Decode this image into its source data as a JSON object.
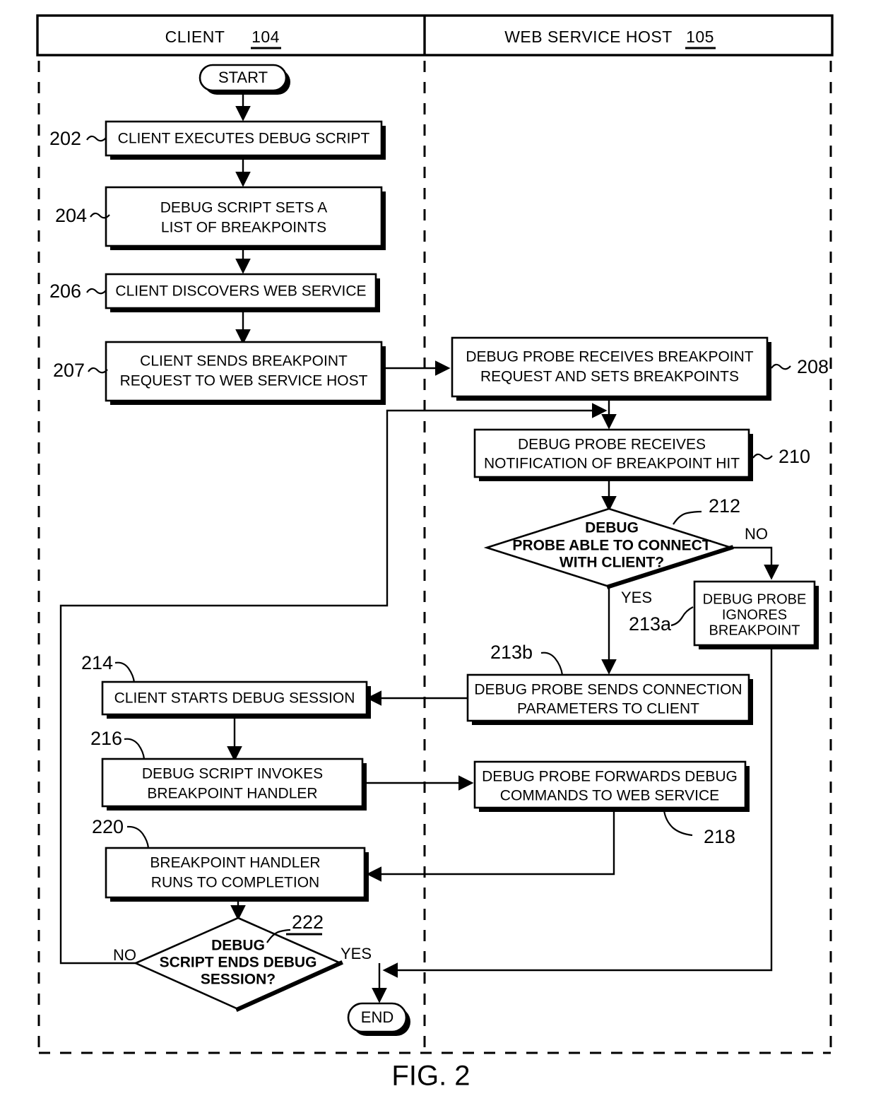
{
  "figure": {
    "caption": "FIG. 2"
  },
  "lanes": [
    {
      "id": "client",
      "title": "CLIENT",
      "ref": "104"
    },
    {
      "id": "web_service_host",
      "title": "WEB SERVICE HOST",
      "ref": "105"
    }
  ],
  "terminators": {
    "start": "START",
    "end": "END"
  },
  "branch_labels": {
    "d212_no": "NO",
    "d212_yes": "YES",
    "d222_no": "NO",
    "d222_yes": "YES"
  },
  "nodes": {
    "n202": {
      "ref": "202",
      "line1": "CLIENT EXECUTES DEBUG SCRIPT",
      "line2": ""
    },
    "n204": {
      "ref": "204",
      "line1": "DEBUG SCRIPT SETS A",
      "line2": "LIST OF BREAKPOINTS"
    },
    "n206": {
      "ref": "206",
      "line1": "CLIENT DISCOVERS WEB SERVICE",
      "line2": ""
    },
    "n207": {
      "ref": "207",
      "line1": "CLIENT SENDS BREAKPOINT",
      "line2": "REQUEST TO WEB SERVICE HOST"
    },
    "n208": {
      "ref": "208",
      "line1": "DEBUG PROBE RECEIVES BREAKPOINT",
      "line2": "REQUEST AND SETS BREAKPOINTS"
    },
    "n210": {
      "ref": "210",
      "line1": "DEBUG PROBE RECEIVES",
      "line2": "NOTIFICATION OF BREAKPOINT HIT"
    },
    "n212": {
      "ref": "212",
      "line1": "DEBUG",
      "line2": "PROBE ABLE TO CONNECT",
      "line3": "WITH  CLIENT?"
    },
    "n213a": {
      "ref": "213a",
      "line1": "DEBUG PROBE",
      "line2": "IGNORES",
      "line3": "BREAKPOINT"
    },
    "n213b": {
      "ref": "213b",
      "line1": "DEBUG PROBE SENDS CONNECTION",
      "line2": "PARAMETERS TO CLIENT"
    },
    "n214": {
      "ref": "214",
      "line1": "CLIENT STARTS DEBUG SESSION",
      "line2": ""
    },
    "n216": {
      "ref": "216",
      "line1": "DEBUG SCRIPT INVOKES",
      "line2": "BREAKPOINT HANDLER"
    },
    "n218": {
      "ref": "218",
      "line1": "DEBUG PROBE FORWARDS DEBUG",
      "line2": "COMMANDS TO WEB SERVICE"
    },
    "n220": {
      "ref": "220",
      "line1": "BREAKPOINT HANDLER",
      "line2": "RUNS TO COMPLETION"
    },
    "n222": {
      "ref": "222",
      "line1": "DEBUG",
      "line2": "SCRIPT ENDS DEBUG",
      "line3": "SESSION?"
    }
  }
}
